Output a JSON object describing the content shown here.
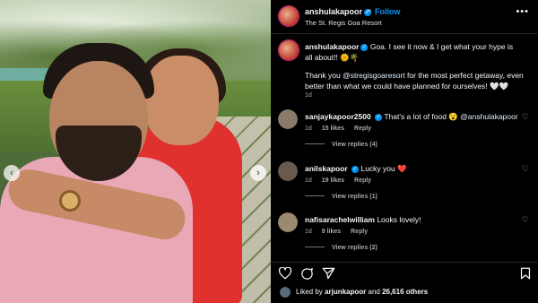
{
  "post": {
    "username": "anshulakapoor",
    "verified_mark": "✓",
    "dot": "•",
    "follow_label": "Follow",
    "location": "The St. Regis Goa Resort",
    "more_label": "•••",
    "caption_line1": "Goa. I see it now & I get what your hype is all about!! 🌞🌴",
    "caption_line2_pre": "Thank you ",
    "caption_mention": "@stregisgoaresort",
    "caption_line2_post": " for the most perfect getaway, even better than what we could have planned for ourselves! 🤍🤍",
    "caption_time": "1d",
    "prev_icon": "‹",
    "next_icon": "›"
  },
  "comments": [
    {
      "username": "sanjaykapoor2500",
      "text": "That's a lot of food 😮 ",
      "mention": "@anshulakapoor",
      "time": "1d",
      "likes": "15 likes",
      "reply": "Reply",
      "view_replies": "View replies (4)",
      "avatar_color": "#8a7a6a"
    },
    {
      "username": "anilskapoor",
      "text": "Lucky you ❤️",
      "mention": "",
      "time": "1d",
      "likes": "19 likes",
      "reply": "Reply",
      "view_replies": "View replies (1)",
      "avatar_color": "#6a5a4e"
    },
    {
      "username": "nafisarachelwilliam",
      "text": "Looks lovely!",
      "mention": "",
      "time": "1d",
      "likes": "9 likes",
      "reply": "Reply",
      "view_replies": "View replies (2)",
      "avatar_color": "#9a8a70"
    }
  ],
  "likes": {
    "prefix": "Liked by ",
    "user": "arjunkapoor",
    "middle": " and ",
    "count": "26,616 others"
  },
  "colors": {
    "accent": "#0095f6",
    "background": "#000000",
    "ring": "#d62976",
    "heart_red": "#ff3040"
  }
}
